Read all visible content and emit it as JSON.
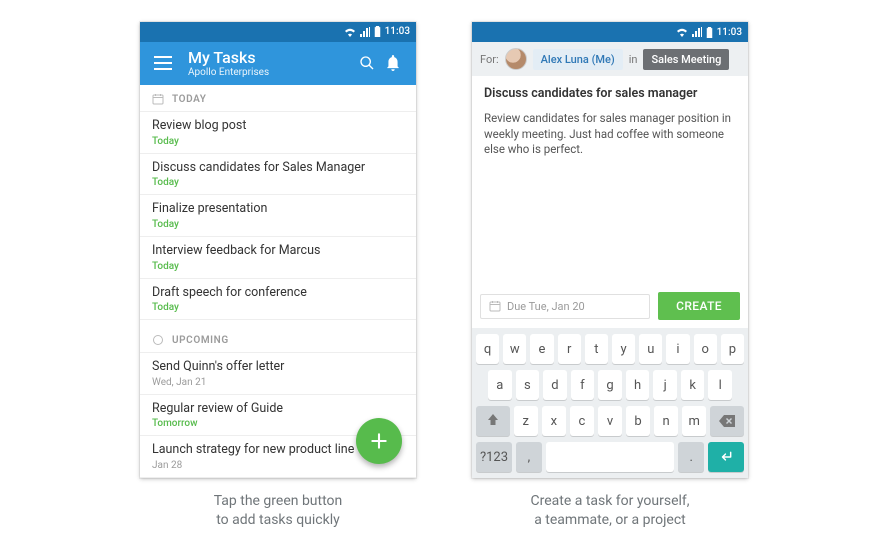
{
  "status": {
    "time": "11:03"
  },
  "phone1": {
    "title": "My Tasks",
    "subtitle": "Apollo Enterprises",
    "sections": {
      "today": {
        "label": "TODAY",
        "tasks": [
          {
            "title": "Review blog post",
            "meta": "Today",
            "metaClass": "green"
          },
          {
            "title": "Discuss candidates for Sales Manager",
            "meta": "Today",
            "metaClass": "green"
          },
          {
            "title": "Finalize presentation",
            "meta": "Today",
            "metaClass": "green"
          },
          {
            "title": "Interview feedback for Marcus",
            "meta": "Today",
            "metaClass": "green"
          },
          {
            "title": "Draft speech for conference",
            "meta": "Today",
            "metaClass": "green"
          }
        ]
      },
      "upcoming": {
        "label": "UPCOMING",
        "tasks": [
          {
            "title": "Send Quinn's offer letter",
            "meta": "Wed, Jan 21",
            "metaClass": "grey"
          },
          {
            "title": "Regular review of Guide",
            "meta": "Tomorrow",
            "metaClass": "green"
          },
          {
            "title": "Launch strategy for new product line",
            "meta": "Jan 28",
            "metaClass": "grey"
          }
        ]
      }
    }
  },
  "phone2": {
    "for_label": "For:",
    "in_label": "in",
    "assignee": "Alex Luna (Me)",
    "project": "Sales Meeting",
    "task_title": "Discuss candidates for sales manager",
    "task_notes": "Review candidates for sales manager position in weekly meeting. Just had coffee with someone else who is perfect.",
    "due_text": "Due Tue, Jan 20",
    "create_label": "CREATE",
    "kb": {
      "r1": [
        "q",
        "w",
        "e",
        "r",
        "t",
        "y",
        "u",
        "i",
        "o",
        "p"
      ],
      "r2": [
        "a",
        "s",
        "d",
        "f",
        "g",
        "h",
        "j",
        "k",
        "l"
      ],
      "r3_mid": [
        "z",
        "x",
        "c",
        "v",
        "b",
        "n",
        "m"
      ],
      "sym": "?123",
      "comma": ",",
      "period": "."
    }
  },
  "captions": {
    "left_l1": "Tap the green button",
    "left_l2": "to add tasks quickly",
    "right_l1": "Create a task for yourself,",
    "right_l2": "a teammate, or a project"
  }
}
